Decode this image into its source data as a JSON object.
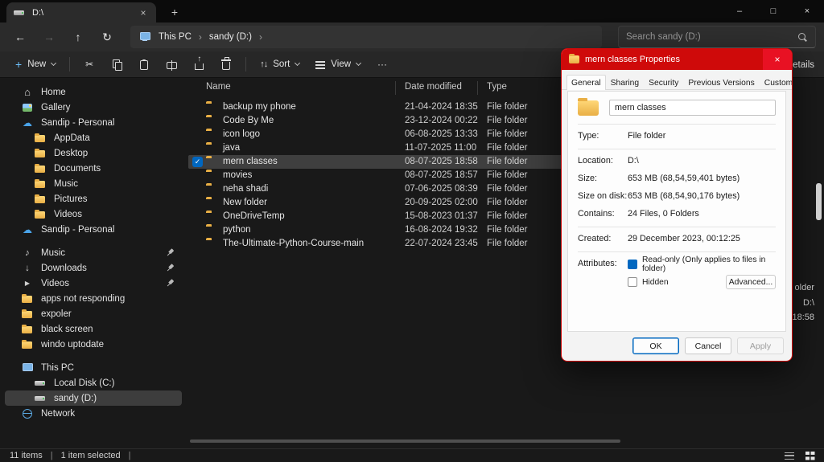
{
  "icons": {
    "back": "←",
    "forward": "→",
    "up": "↑",
    "refresh": "↻",
    "chevron_right": "›",
    "close": "×",
    "minimize": "–",
    "maximize": "□",
    "plus": "+",
    "more": "···",
    "sort": "↑↓",
    "check": "✓"
  },
  "colors": {
    "accent_blue": "#0067c0",
    "dialog_titlebar_red": "#cf0a0a",
    "folder_yellow": "#e9af45",
    "selection_gray": "#3f3f3f"
  },
  "titlebar": {
    "tab_label": "D:\\"
  },
  "navbar": {
    "breadcrumb": [
      "This PC",
      "sandy (D:)"
    ],
    "search_placeholder": "Search sandy (D:)"
  },
  "commandbar": {
    "new_label": "New",
    "sort_label": "Sort",
    "view_label": "View",
    "details_label": "Details"
  },
  "sidebar": {
    "icon_glyphs": {
      "home": "⌂",
      "cloud": "☁",
      "music": "♪",
      "download": "↓",
      "video": "▶"
    },
    "items": [
      {
        "label": "Home",
        "icon": "home"
      },
      {
        "label": "Gallery",
        "icon": "gallery"
      },
      {
        "label": "Sandip - Personal",
        "icon": "cloud"
      },
      {
        "label": "AppData",
        "icon": "folder",
        "indent": 1
      },
      {
        "label": "Desktop",
        "icon": "folder",
        "indent": 1
      },
      {
        "label": "Documents",
        "icon": "folder",
        "indent": 1
      },
      {
        "label": "Music",
        "icon": "folder",
        "indent": 1
      },
      {
        "label": "Pictures",
        "icon": "folder",
        "indent": 1
      },
      {
        "label": "Videos",
        "icon": "folder",
        "indent": 1
      },
      {
        "label": "Sandip - Personal",
        "icon": "cloud"
      },
      {
        "divider": true
      },
      {
        "label": "Music",
        "icon": "music",
        "pinned": true
      },
      {
        "label": "Downloads",
        "icon": "download",
        "pinned": true
      },
      {
        "label": "Videos",
        "icon": "video",
        "pinned": true
      },
      {
        "label": "apps not responding",
        "icon": "folder"
      },
      {
        "label": "expoler",
        "icon": "folder"
      },
      {
        "label": "black screen",
        "icon": "folder"
      },
      {
        "label": "windo uptodate",
        "icon": "folder"
      },
      {
        "divider": true
      },
      {
        "label": "This PC",
        "icon": "pc"
      },
      {
        "label": "Local Disk (C:)",
        "icon": "drive",
        "indent": 1
      },
      {
        "label": "sandy (D:)",
        "icon": "drive",
        "indent": 1,
        "selected": true
      },
      {
        "label": "Network",
        "icon": "network"
      }
    ]
  },
  "filelist": {
    "columns": [
      "Name",
      "Date modified",
      "Type"
    ],
    "rows": [
      {
        "name": "backup my phone",
        "date": "21-04-2024 18:35",
        "type": "File folder"
      },
      {
        "name": "Code By Me",
        "date": "23-12-2024 00:22",
        "type": "File folder"
      },
      {
        "name": "icon logo",
        "date": "06-08-2025 13:33",
        "type": "File folder"
      },
      {
        "name": "java",
        "date": "11-07-2025 11:00",
        "type": "File folder"
      },
      {
        "name": "mern classes",
        "date": "08-07-2025 18:58",
        "type": "File folder",
        "selected": true
      },
      {
        "name": "movies",
        "date": "08-07-2025 18:57",
        "type": "File folder"
      },
      {
        "name": "neha shadi",
        "date": "07-06-2025 08:39",
        "type": "File folder"
      },
      {
        "name": "New folder",
        "date": "20-09-2025 02:00",
        "type": "File folder"
      },
      {
        "name": "OneDriveTemp",
        "date": "15-08-2023 01:37",
        "type": "File folder"
      },
      {
        "name": "python",
        "date": "16-08-2024 19:32",
        "type": "File folder"
      },
      {
        "name": "The-Ultimate-Python-Course-main",
        "date": "22-07-2024 23:45",
        "type": "File folder"
      }
    ]
  },
  "details_pane": {
    "fragments": [
      "older",
      "D:\\",
      "18:58"
    ]
  },
  "dialog": {
    "title": "mern classes Properties",
    "tabs": [
      "General",
      "Sharing",
      "Security",
      "Previous Versions",
      "Customize"
    ],
    "active_tab": 0,
    "name_value": "mern classes",
    "sections": [
      {
        "rows": [
          {
            "label": "Type:",
            "value": "File folder"
          }
        ]
      },
      {
        "rows": [
          {
            "label": "Location:",
            "value": "D:\\"
          },
          {
            "label": "Size:",
            "value": "653 MB (68,54,59,401 bytes)"
          },
          {
            "label": "Size on disk:",
            "value": "653 MB (68,54,90,176 bytes)"
          },
          {
            "label": "Contains:",
            "value": "24 Files, 0 Folders"
          }
        ]
      },
      {
        "rows": [
          {
            "label": "Created:",
            "value": "29 December 2023, 00:12:25"
          }
        ]
      }
    ],
    "attributes_label": "Attributes:",
    "readonly_label": "Read-only (Only applies to files in folder)",
    "hidden_label": "Hidden",
    "advanced_label": "Advanced...",
    "ok_label": "OK",
    "cancel_label": "Cancel",
    "apply_label": "Apply"
  },
  "statusbar": {
    "items_label": "11 items",
    "selected_label": "1 item selected"
  }
}
